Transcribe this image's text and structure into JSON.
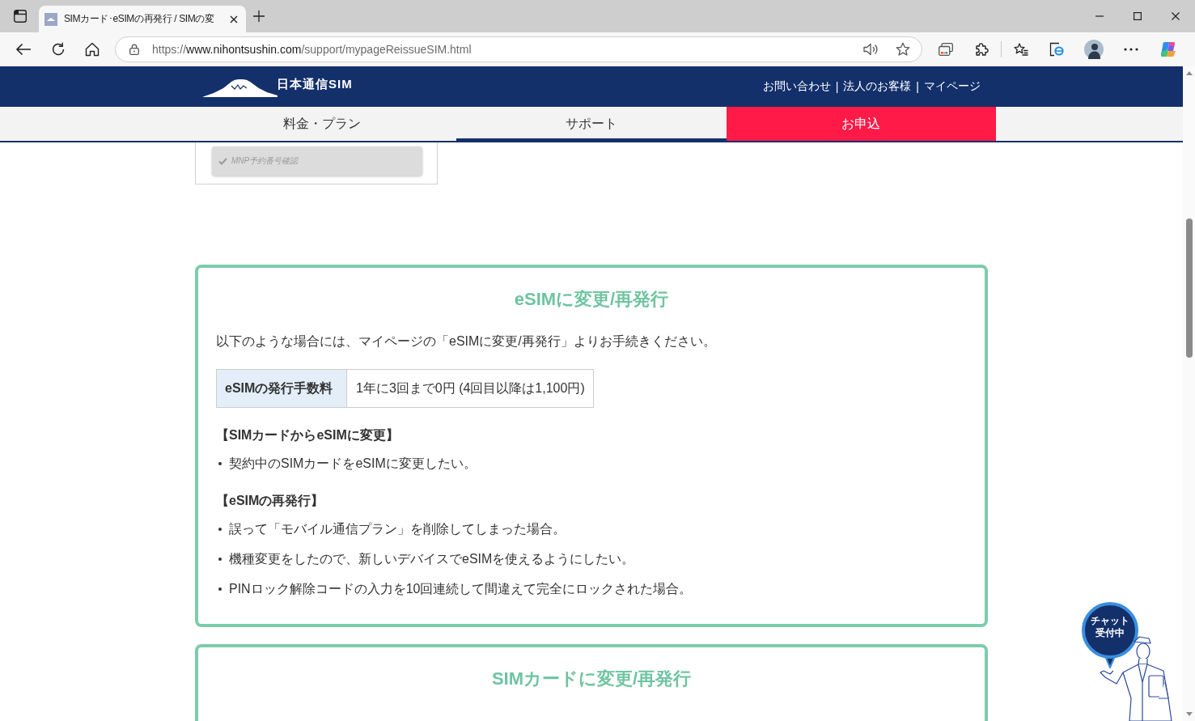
{
  "browser": {
    "tab": {
      "title": "SIMカード･eSIMの再発行 / SIMの変"
    },
    "address_bar": {
      "url_scheme": "https://",
      "url_host": "www.nihontsushin.com",
      "url_path": "/support/mypageReissueSIM.html"
    }
  },
  "site_header": {
    "logo_text": "日本通信SIM",
    "top_links": [
      {
        "label": "お問い合わせ"
      },
      {
        "label": "法人のお客様"
      },
      {
        "label": "マイページ"
      }
    ],
    "separators": [
      "|",
      "|"
    ]
  },
  "nav": [
    {
      "label": "料金・プラン",
      "selected": false,
      "kind": "link"
    },
    {
      "label": "サポート",
      "selected": true,
      "kind": "link"
    },
    {
      "label": "お申込",
      "selected": false,
      "kind": "cta"
    }
  ],
  "previous_panel": {
    "button": {
      "label": "MNP予約番号確認",
      "disabled": true
    }
  },
  "cards": [
    {
      "title": "eSIMに変更/再発行",
      "intro": "以下のような場合には、マイページの「eSIMに変更/再発行」よりお手続きください。",
      "fee": {
        "label": "eSIMの発行手数料",
        "value": "1年に3回まで0円 (4回目以降は1,100円)"
      },
      "sections": [
        {
          "heading": "【SIMカードからeSIMに変更】",
          "bullets": [
            "契約中のSIMカードをeSIMに変更したい。"
          ]
        },
        {
          "heading": "【eSIMの再発行】",
          "bullets": [
            "誤って「モバイル通信プラン」を削除してしまった場合。",
            "機種変更をしたので、新しいデバイスでeSIMを使えるようにしたい。",
            "PINロック解除コードの入力を10回連続して間違えて完全にロックされた場合。"
          ]
        }
      ]
    },
    {
      "title": "SIMカードに変更/再発行"
    }
  ],
  "chat_badge": {
    "label": "チャット受付中"
  }
}
